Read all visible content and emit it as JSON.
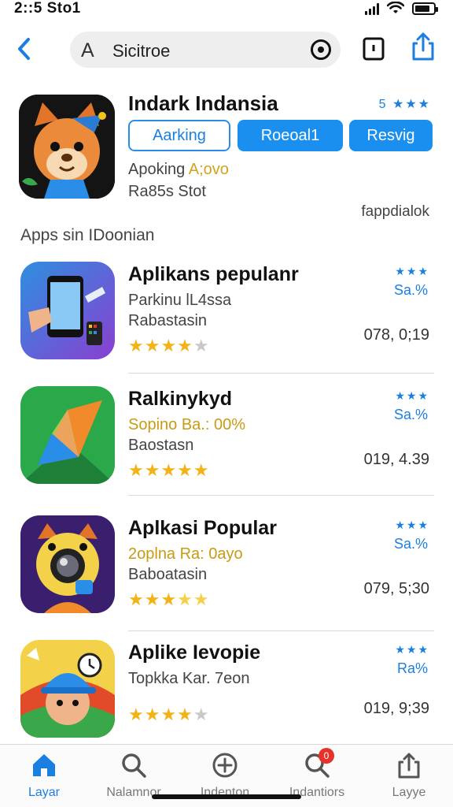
{
  "status_bar": {
    "time": "2::5 Sto1"
  },
  "nav": {
    "search_text": "Sicitroe",
    "search_prefix": "A"
  },
  "featured": {
    "title": "Indark Indansia",
    "rating": "5 ★★★",
    "buttons": [
      "Aarking",
      "Roeoal1",
      "Resvig"
    ],
    "sub1_prefix": "Apoking ",
    "sub1_highlight": "A;ovo",
    "sub2": "Ra85s Stot",
    "link": "fappdialok"
  },
  "section_title": "Apps sin IDoonian",
  "apps": [
    {
      "name": "Aplikans pepulanr",
      "line1": "Parkinu lL4ssa",
      "line2": "Rabastasin",
      "rating": 4,
      "dots": "★★★",
      "pct": "Sa.%",
      "meta": "078, 0;19"
    },
    {
      "name": "Ralkinykyd",
      "line1": "Sopino Ba.: 00%",
      "line2": "Baostasn",
      "rating": 5,
      "dots": "★★★",
      "pct": "Sa.%",
      "meta": "019, 4.39"
    },
    {
      "name": "Aplkasi Popular",
      "line1": "2oplna Ra: 0ayo",
      "line2": "Baboatasin",
      "rating": 3,
      "dots": "★★★",
      "pct": "Sa.%",
      "meta": "079, 5;30"
    },
    {
      "name": "Aplike Ievopie",
      "line1": "Topkka Kar. 7eon",
      "line2": "",
      "rating": 4,
      "dots": "★★★",
      "pct": "Ra%",
      "meta": "019, 9;39"
    }
  ],
  "tabs": [
    {
      "label": "Layar",
      "icon": "home-icon",
      "active": true
    },
    {
      "label": "Nalamnor",
      "icon": "search-icon",
      "active": false
    },
    {
      "label": "Indenton",
      "icon": "add-circle-icon",
      "active": false
    },
    {
      "label": "Indantiors",
      "icon": "notifications-icon",
      "active": false,
      "badge": "0"
    },
    {
      "label": "Layye",
      "icon": "share-icon",
      "active": false
    }
  ],
  "colors": {
    "accent": "#1a8ff0",
    "star": "#f3b316",
    "badge": "#e5332a"
  }
}
